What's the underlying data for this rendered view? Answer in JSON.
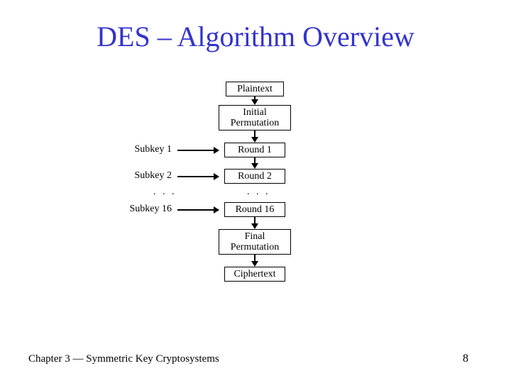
{
  "title": "DES – Algorithm Overview",
  "footer": {
    "left": "Chapter 3 — Symmetric Key Cryptosystems",
    "right": "8"
  },
  "diagram": {
    "plaintext": "Plaintext",
    "initial_perm_line1": "Initial",
    "initial_perm_line2": "Permutation",
    "round1": "Round 1",
    "round2": "Round 2",
    "round16": "Round 16",
    "final_perm_line1": "Final",
    "final_perm_line2": "Permutation",
    "ciphertext": "Ciphertext",
    "subkey1": "Subkey 1",
    "subkey2": "Subkey 2",
    "subkey16": "Subkey 16",
    "dots": ". . .",
    "dots2": ". . ."
  }
}
